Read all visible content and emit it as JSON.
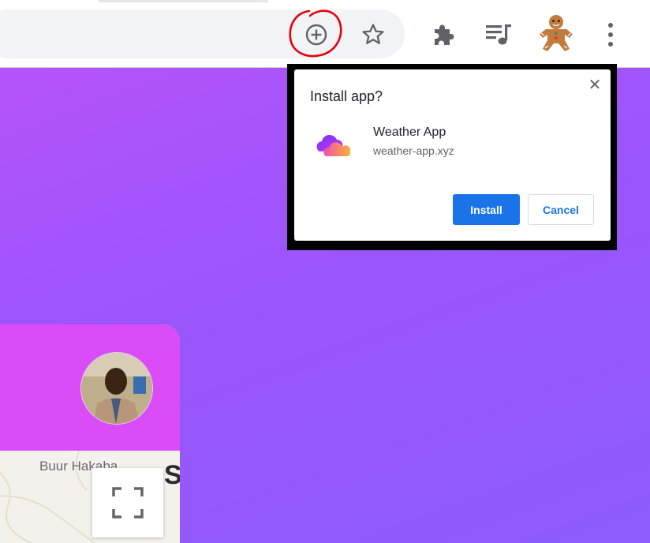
{
  "toolbar": {
    "icons": [
      "install-app-icon",
      "bookmark-star-icon",
      "extensions-puzzle-icon",
      "media-control-icon",
      "gingerbread-profile-icon",
      "more-menu-icon"
    ]
  },
  "dialog": {
    "title": "Install app?",
    "close_glyph": "✕",
    "app_name": "Weather App",
    "app_url": "weather-app.xyz",
    "install_label": "Install",
    "cancel_label": "Cancel"
  },
  "page": {
    "map_place": "Buur Hakaba",
    "map_letter": "S"
  },
  "colors": {
    "accent": "#1a73e8",
    "page_gradient_start": "#b553fb",
    "page_gradient_end": "#8d5cfb",
    "card_header": "#d94cf8",
    "annotation": "#e3000f"
  }
}
